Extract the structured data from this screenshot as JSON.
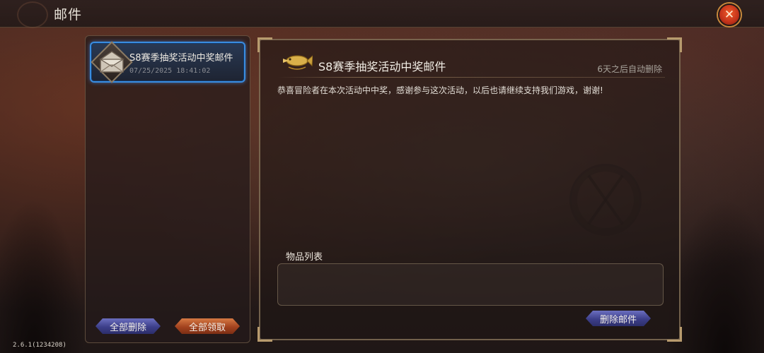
{
  "header": {
    "title": "邮件",
    "close_icon": "close-icon"
  },
  "mail_list": {
    "items": [
      {
        "subject": "S8赛季抽奖活动中奖邮件",
        "date": "07/25/2025 18:41:02",
        "icon": "envelope-open-icon",
        "selected": true
      }
    ],
    "delete_all_label": "全部删除",
    "claim_all_label": "全部领取"
  },
  "mail_detail": {
    "icon": "airship-fish-icon",
    "title": "S8赛季抽奖活动中奖邮件",
    "auto_delete": "6天之后自动删除",
    "body": "恭喜冒险者在本次活动中中奖，感谢参与这次活动，以后也请继续支持我们游戏，谢谢!",
    "items_label": "物品列表",
    "items": [],
    "delete_mail_label": "删除邮件"
  },
  "version": "2.6.1(1234208)",
  "colors": {
    "selected_border": "#3a8de0",
    "button_blue": "#3d3f8a",
    "button_orange": "#a3431f",
    "close_red": "#c2321a"
  }
}
